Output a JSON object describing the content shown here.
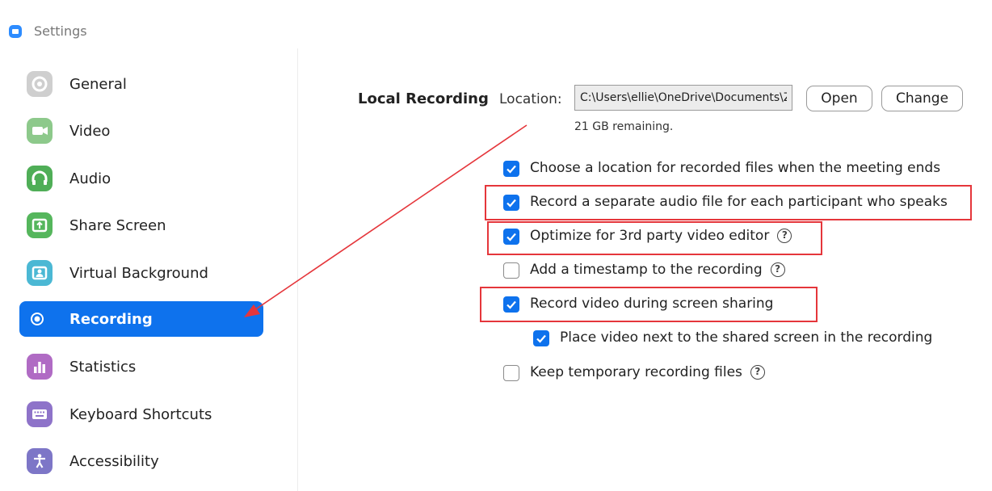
{
  "window": {
    "title": "Settings"
  },
  "sidebar": {
    "items": [
      {
        "label": "General",
        "icon": "gear-icon",
        "color": "#c9c9c9"
      },
      {
        "label": "Video",
        "icon": "video-camera-icon",
        "color": "#7fc37d"
      },
      {
        "label": "Audio",
        "icon": "headphones-icon",
        "color": "#4fae57"
      },
      {
        "label": "Share Screen",
        "icon": "share-screen-icon",
        "color": "#55b65c"
      },
      {
        "label": "Virtual Background",
        "icon": "person-icon",
        "color": "#4bb8d4"
      },
      {
        "label": "Recording",
        "icon": "record-icon",
        "color": "#0e72ed",
        "active": true
      },
      {
        "label": "Statistics",
        "icon": "bar-chart-icon",
        "color": "#b06bc4"
      },
      {
        "label": "Keyboard Shortcuts",
        "icon": "keyboard-icon",
        "color": "#8e73c9"
      },
      {
        "label": "Accessibility",
        "icon": "accessibility-icon",
        "color": "#7d76c7"
      }
    ]
  },
  "local_recording": {
    "title": "Local Recording",
    "location_label": "Location:",
    "location_value": "C:\\Users\\ellie\\OneDrive\\Documents\\Zoom",
    "open_label": "Open",
    "change_label": "Change",
    "remaining": "21 GB remaining."
  },
  "options": [
    {
      "label": "Choose a location for recorded files when the meeting ends",
      "checked": true,
      "help": false
    },
    {
      "label": "Record a separate audio file for each participant who speaks",
      "checked": true,
      "help": false
    },
    {
      "label": "Optimize for 3rd party video editor",
      "checked": true,
      "help": true
    },
    {
      "label": "Add a timestamp to the recording",
      "checked": false,
      "help": true
    },
    {
      "label": "Record video during screen sharing",
      "checked": true,
      "help": false
    },
    {
      "label": "Place video next to the shared screen in the recording",
      "checked": true,
      "help": false
    },
    {
      "label": "Keep temporary recording files",
      "checked": false,
      "help": true
    }
  ],
  "help_glyph": "?",
  "colors": {
    "accent": "#0e72ed",
    "annotation": "#e5363b"
  }
}
